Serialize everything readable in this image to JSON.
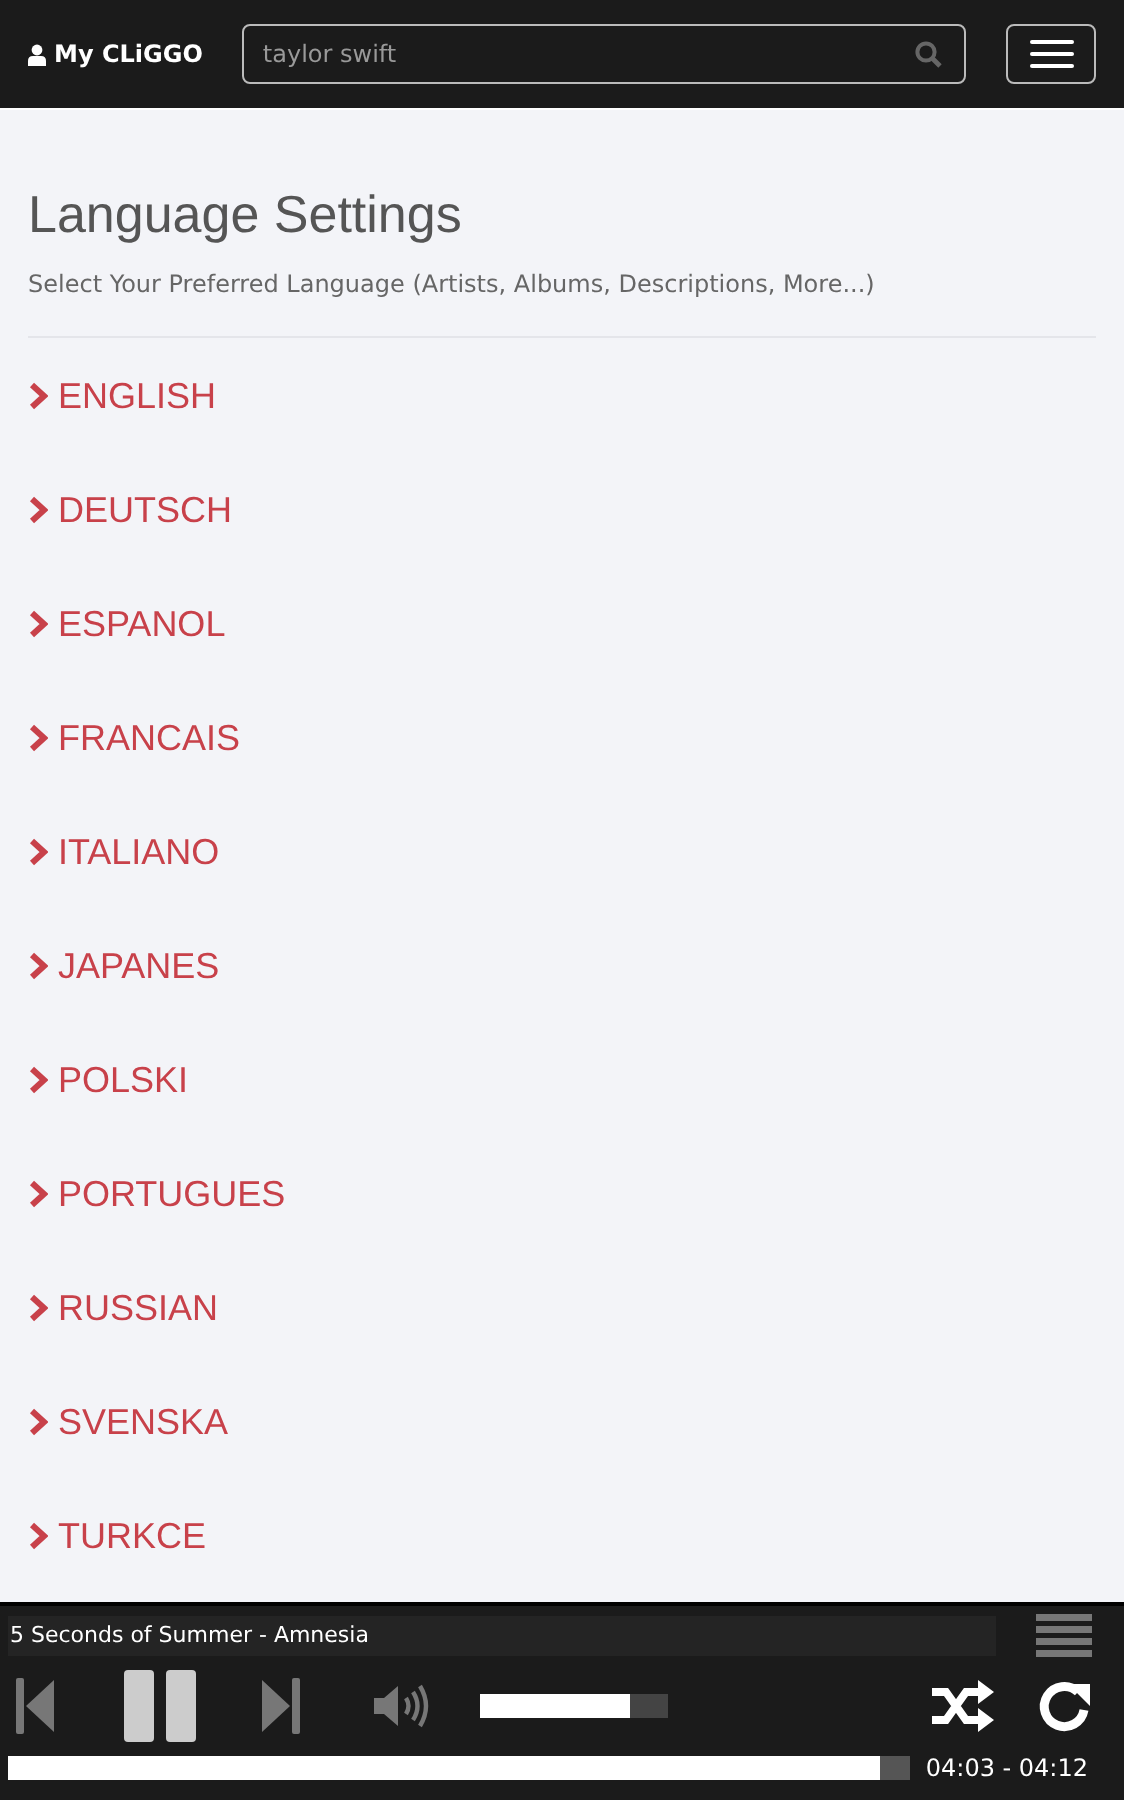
{
  "navbar": {
    "brand": "My CLiGGO",
    "search": {
      "value": "taylor swift"
    }
  },
  "page": {
    "title": "Language Settings",
    "subtitle": "Select Your Preferred Language (Artists, Albums, Descriptions, More...)"
  },
  "languages": [
    "ENGLISH",
    "DEUTSCH",
    "ESPANOL",
    "FRANCAIS",
    "ITALIANO",
    "JAPANES",
    "POLSKI",
    "PORTUGUES",
    "RUSSIAN",
    "SVENSKA",
    "TURKCE"
  ],
  "player": {
    "track": "5 Seconds of Summer - Amnesia",
    "volume": {
      "level": 0.8
    },
    "progress": {
      "level": 0.966
    },
    "time": "04:03 - 04:12"
  }
}
